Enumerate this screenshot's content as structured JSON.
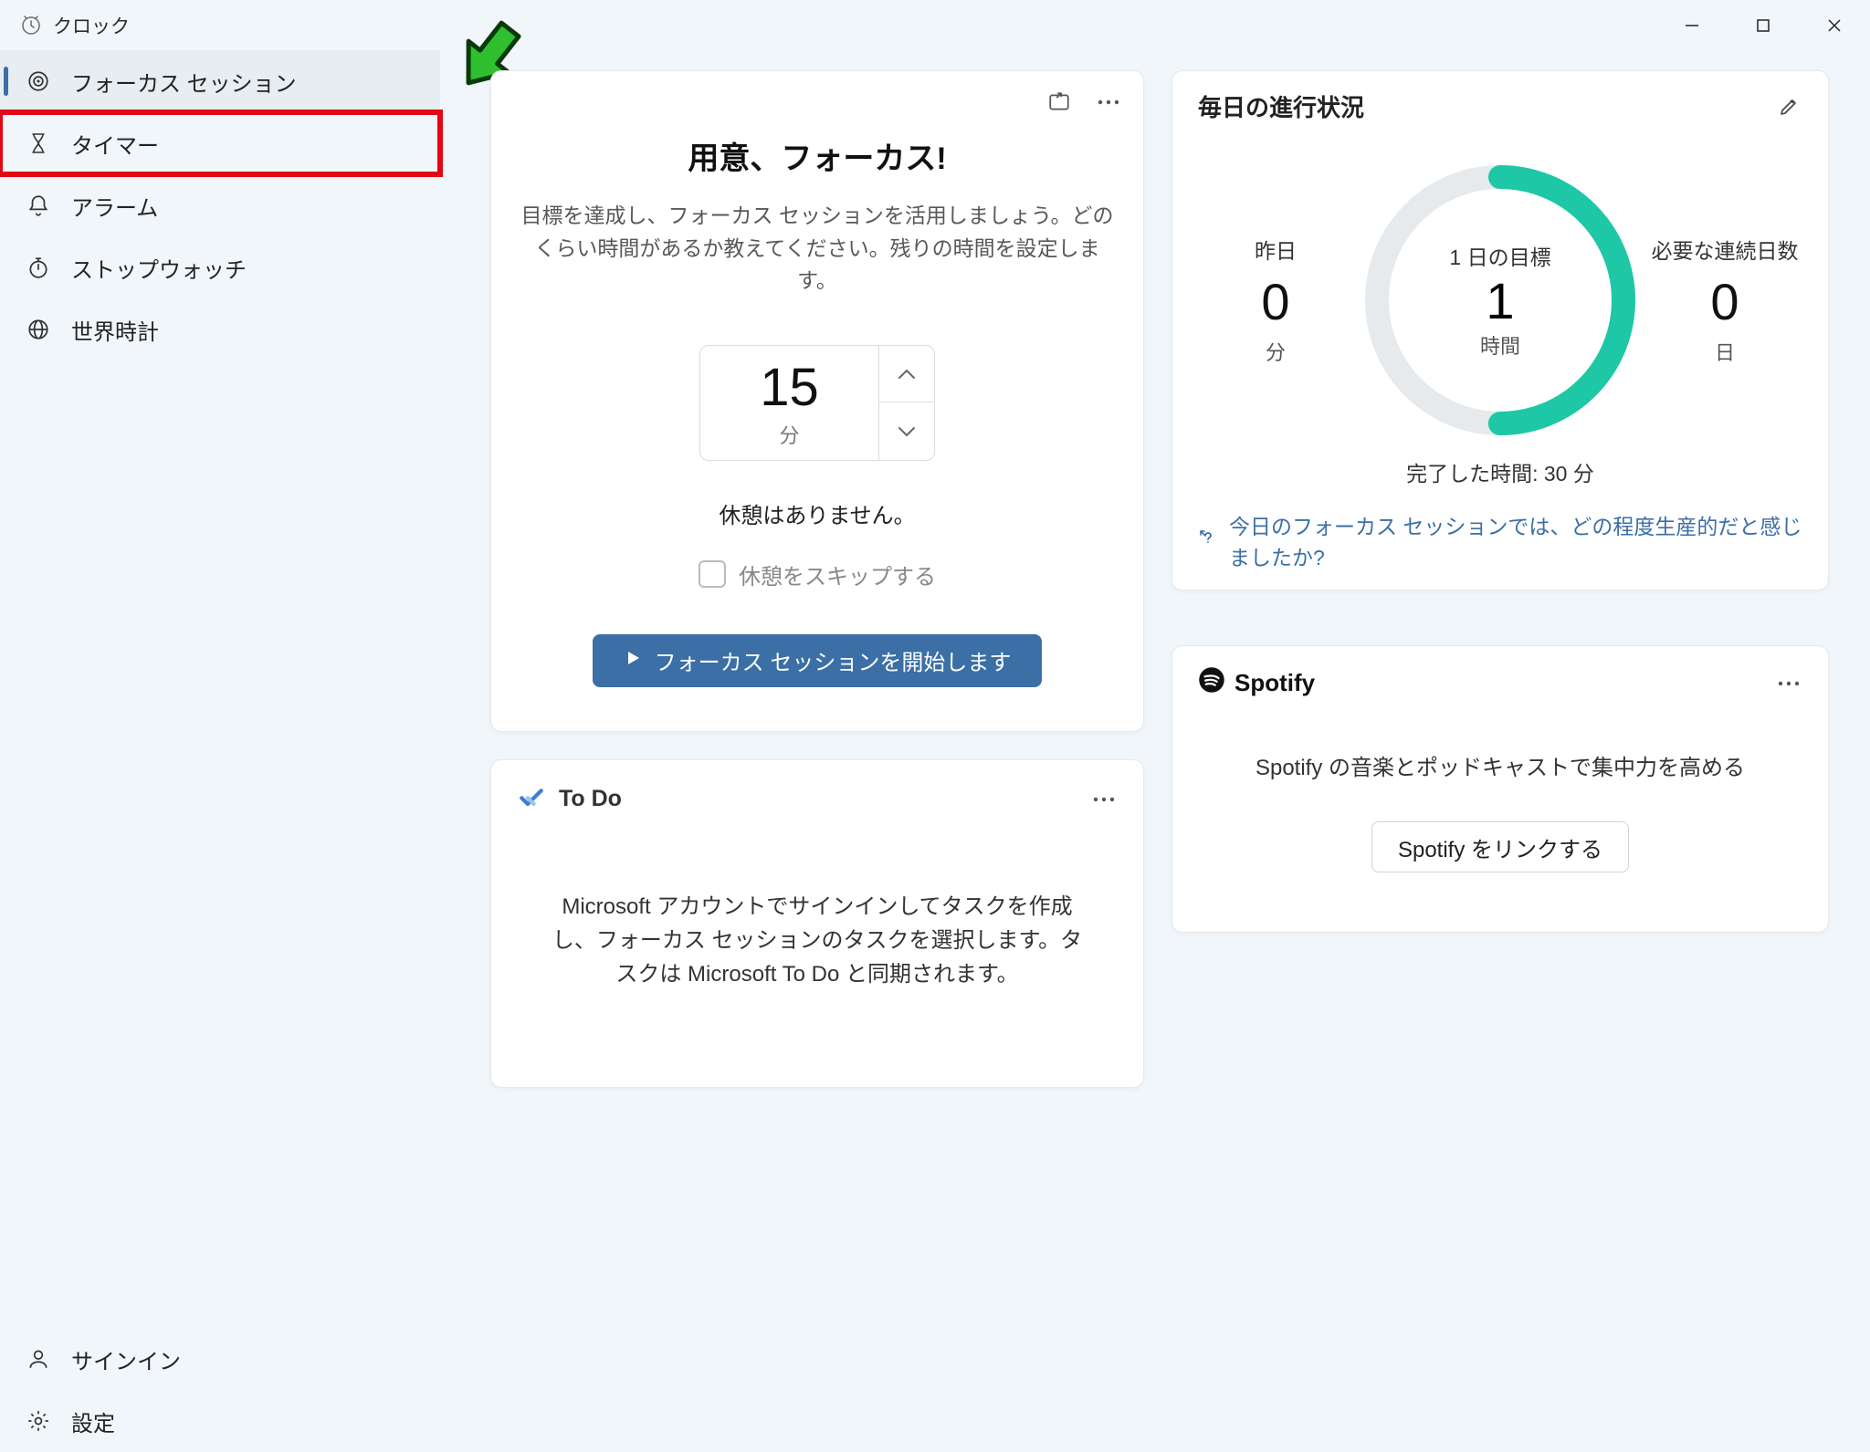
{
  "app": {
    "title": "クロック"
  },
  "sidebar": {
    "items": [
      {
        "label": "フォーカス セッション"
      },
      {
        "label": "タイマー"
      },
      {
        "label": "アラーム"
      },
      {
        "label": "ストップウォッチ"
      },
      {
        "label": "世界時計"
      }
    ],
    "signin": "サインイン",
    "settings": "設定"
  },
  "focus": {
    "title": "用意、フォーカス!",
    "description": "目標を達成し、フォーカス セッションを活用しましょう。どのくらい時間があるか教えてください。残りの時間を設定します。",
    "minutes_value": "15",
    "minutes_unit": "分",
    "break_text": "休憩はありません。",
    "skip_breaks": "休憩をスキップする",
    "start_button": "フォーカス セッションを開始します"
  },
  "progress": {
    "title": "毎日の進行状況",
    "yesterday": {
      "label": "昨日",
      "value": "0",
      "unit": "分"
    },
    "goal": {
      "label": "1 日の目標",
      "value": "1",
      "unit": "時間"
    },
    "streak": {
      "label": "必要な連続日数",
      "value": "0",
      "unit": "日"
    },
    "completed": "完了した時間: 30 分",
    "feedback": "今日のフォーカス セッションでは、どの程度生産的だと感じましたか?"
  },
  "spotify": {
    "brand": "Spotify",
    "description": "Spotify の音楽とポッドキャストで集中力を高める",
    "link_button": "Spotify をリンクする"
  },
  "todo": {
    "title": "To Do",
    "body": "Microsoft アカウントでサインインしてタスクを作成し、フォーカス セッションのタスクを選択します。タスクは Microsoft To Do と同期されます。"
  },
  "chart_data": {
    "type": "pie",
    "title": "1 日の目標",
    "series": [
      {
        "name": "完了",
        "value": 30,
        "unit": "分"
      },
      {
        "name": "目標",
        "value": 60,
        "unit": "分"
      }
    ],
    "percent_complete": 50
  }
}
